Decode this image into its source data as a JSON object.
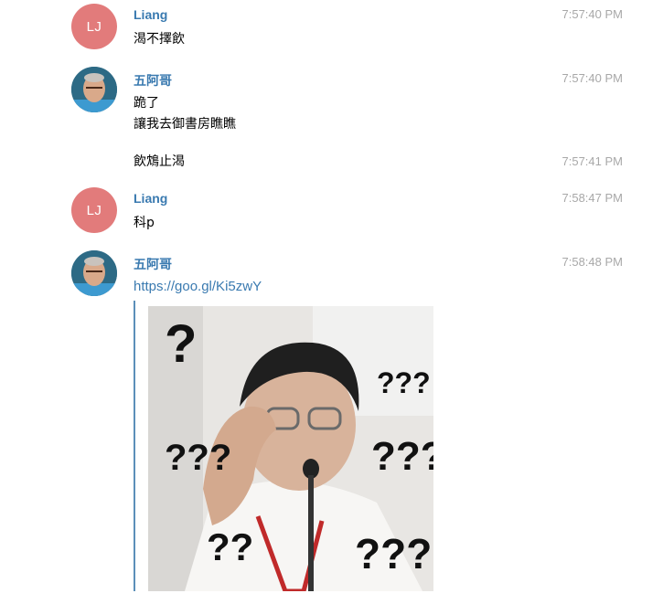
{
  "messages": [
    {
      "sender": "Liang",
      "initials": "LJ",
      "time": "7:57:40 PM",
      "lines": [
        "渴不擇飲"
      ]
    },
    {
      "sender": "五阿哥",
      "time": "7:57:40 PM",
      "lines": [
        "跪了",
        "讓我去御書房瞧瞧"
      ]
    },
    {
      "time": "7:57:41 PM",
      "lines": [
        "飲鴆止渴"
      ]
    },
    {
      "sender": "Liang",
      "initials": "LJ",
      "time": "7:58:47 PM",
      "lines": [
        "科p"
      ]
    },
    {
      "sender": "五阿哥",
      "time": "7:58:48 PM",
      "link": "https://goo.gl/Ki5zwY"
    }
  ],
  "preview": {
    "marks": [
      "?",
      "???",
      "???",
      "???",
      "??",
      "???"
    ]
  },
  "colors": {
    "name": "#3a7ab0",
    "time": "#a8a8a8",
    "avatar_initials_bg": "#e27b7b",
    "link": "#3a7ab0",
    "preview_bar": "#5b8fb9"
  }
}
